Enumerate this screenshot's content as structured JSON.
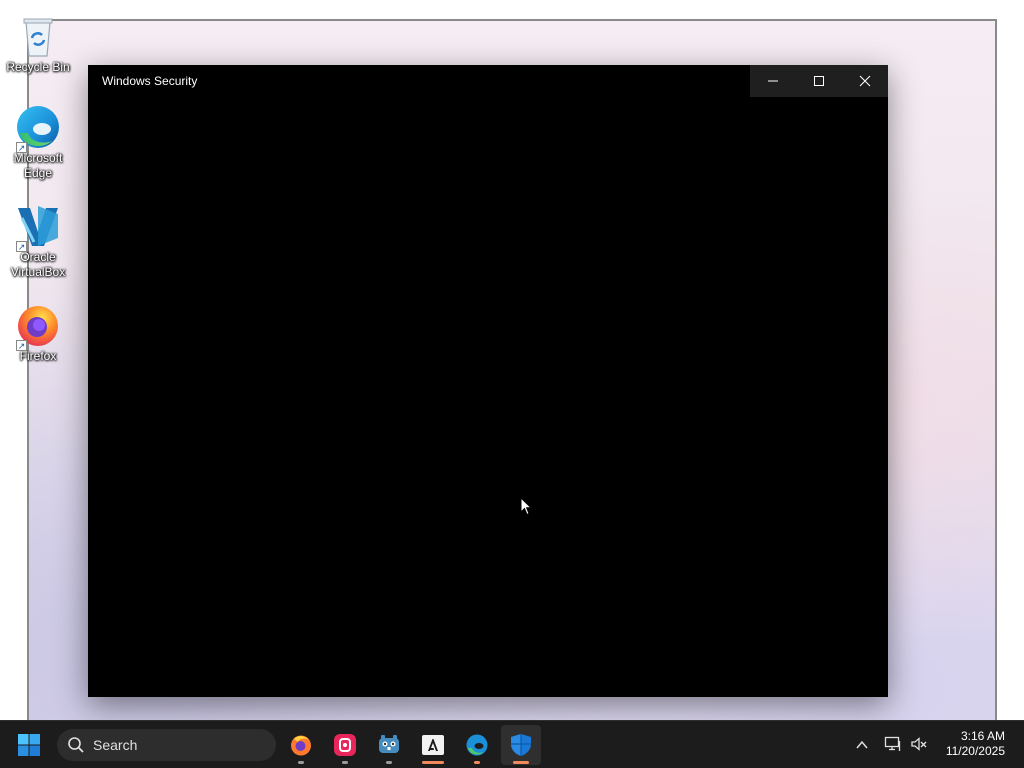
{
  "desktop": {
    "icons": [
      {
        "label": "Recycle Bin",
        "icon": "recycle-bin-icon"
      },
      {
        "label": "Microsoft Edge",
        "icon": "edge-icon"
      },
      {
        "label": "Oracle VirtualBox",
        "icon": "virtualbox-icon"
      },
      {
        "label": "Firefox",
        "icon": "firefox-icon"
      }
    ]
  },
  "window": {
    "title": "Windows Security",
    "controls": [
      "minimize",
      "maximize",
      "close"
    ]
  },
  "taskbar": {
    "search_label": "Search",
    "apps": [
      {
        "name": "Firefox",
        "icon": "firefox-icon",
        "state": "running"
      },
      {
        "name": "Recorder",
        "icon": "recorder-icon",
        "state": "running"
      },
      {
        "name": "Godot",
        "icon": "godot-icon",
        "state": "running"
      },
      {
        "name": "Adobe",
        "icon": "adobe-icon",
        "state": "open"
      },
      {
        "name": "Microsoft Edge",
        "icon": "edge-icon",
        "state": "open"
      },
      {
        "name": "Windows Security",
        "icon": "windows-security-icon",
        "state": "active"
      }
    ],
    "tray": [
      "chevron-up-icon",
      "network-icon",
      "volume-muted-icon"
    ],
    "time": "3:16 AM",
    "date": "11/20/2025"
  },
  "colors": {
    "accent": "#0078d4",
    "indicator_active": "#f08a5d",
    "taskbar_bg": "#1c1c1c",
    "window_bg": "#000000"
  }
}
